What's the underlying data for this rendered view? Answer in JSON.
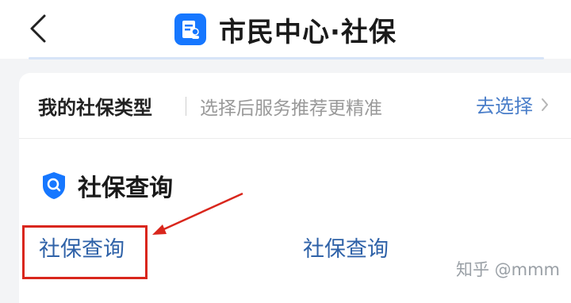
{
  "header": {
    "title": "市民中心·社保",
    "back_icon": "chevron-left-icon",
    "app_icon": "social-security-card-icon"
  },
  "type_row": {
    "label": "我的社保类型",
    "hint": "选择后服务推荐更精准",
    "action": "去选择"
  },
  "section": {
    "title": "社保查询",
    "icon": "shield-search-icon",
    "items": [
      "社保查询",
      "社保查询"
    ]
  },
  "watermark": "知乎 @mmm",
  "colors": {
    "brand": "#1677ff",
    "link": "#2f62a8",
    "highlight": "#d9261c"
  }
}
